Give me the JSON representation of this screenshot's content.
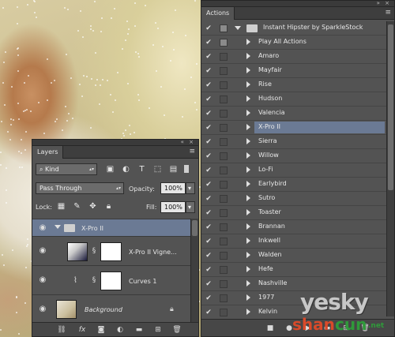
{
  "layers_panel": {
    "tab_label": "Layers",
    "filter_kind": "Kind",
    "blend_mode": "Pass Through",
    "opacity_label": "Opacity:",
    "opacity_value": "100%",
    "lock_label": "Lock:",
    "fill_label": "Fill:",
    "fill_value": "100%",
    "layers": [
      {
        "name": "X-Pro II",
        "type": "group",
        "selected": true
      },
      {
        "name": "X-Pro II Vigne...",
        "type": "adjustment"
      },
      {
        "name": "Curves 1",
        "type": "curves"
      },
      {
        "name": "Background",
        "type": "background",
        "locked": true
      }
    ],
    "footer_icons": [
      "link-icon",
      "fx-icon",
      "mask-icon",
      "adjustment-icon",
      "folder-icon",
      "new-layer-icon",
      "trash-icon"
    ]
  },
  "actions_panel": {
    "tab_label": "Actions",
    "set_name": "Instant Hipster by SparkleStock",
    "actions": [
      "Play All Actions",
      "Amaro",
      "Mayfair",
      "Rise",
      "Hudson",
      "Valencia",
      "X-Pro II",
      "Sierra",
      "Willow",
      "Lo-Fi",
      "Earlybird",
      "Sutro",
      "Toaster",
      "Brannan",
      "Inkwell",
      "Walden",
      "Hefe",
      "Nashville",
      "1977",
      "Kelvin"
    ],
    "selected_action": "X-Pro II"
  },
  "watermark": {
    "top": "yesky",
    "bottom_left": "shan",
    "bottom_mid": "cun",
    "bottom_right": ".net"
  }
}
